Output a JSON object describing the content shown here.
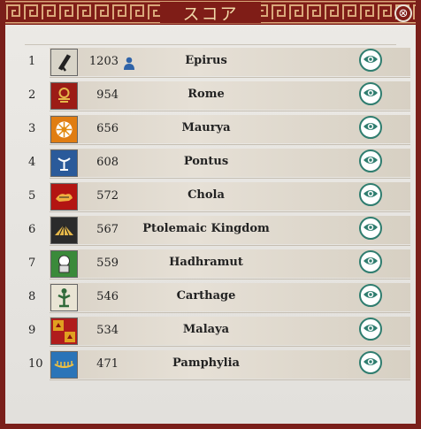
{
  "window": {
    "title": "スコア",
    "close_glyph": "⊗"
  },
  "colors": {
    "frame": "#7f1d17",
    "title_text": "#f0d9a8",
    "eye_teal": "#2f7d6f",
    "player_blue": "#2f63a8"
  },
  "rows": [
    {
      "rank": "1",
      "score": "1203",
      "name": "Epirus",
      "is_player": true,
      "flag": "epirus"
    },
    {
      "rank": "2",
      "score": "954",
      "name": "Rome",
      "is_player": false,
      "flag": "rome"
    },
    {
      "rank": "3",
      "score": "656",
      "name": "Maurya",
      "is_player": false,
      "flag": "maurya"
    },
    {
      "rank": "4",
      "score": "608",
      "name": "Pontus",
      "is_player": false,
      "flag": "pontus"
    },
    {
      "rank": "5",
      "score": "572",
      "name": "Chola",
      "is_player": false,
      "flag": "chola"
    },
    {
      "rank": "6",
      "score": "567",
      "name": "Ptolemaic Kingdom",
      "is_player": false,
      "flag": "ptolemaic"
    },
    {
      "rank": "7",
      "score": "559",
      "name": "Hadhramut",
      "is_player": false,
      "flag": "hadhramut"
    },
    {
      "rank": "8",
      "score": "546",
      "name": "Carthage",
      "is_player": false,
      "flag": "carthage"
    },
    {
      "rank": "9",
      "score": "534",
      "name": "Malaya",
      "is_player": false,
      "flag": "malaya"
    },
    {
      "rank": "10",
      "score": "471",
      "name": "Pamphylia",
      "is_player": false,
      "flag": "pamphylia"
    }
  ],
  "icons": {
    "eye": "eye-icon",
    "player": "person-icon",
    "close": "close-icon"
  }
}
